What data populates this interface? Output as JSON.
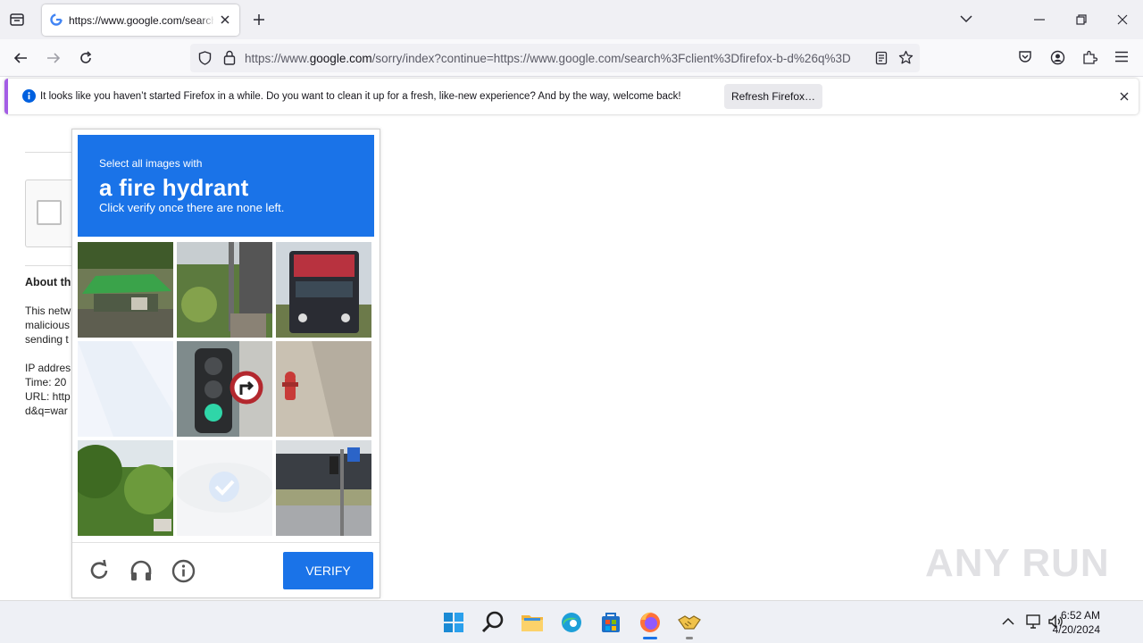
{
  "browser": {
    "tab": {
      "title": "https://www.google.com/search?client=firefox-b-d&q=war"
    },
    "url": {
      "prefix": "https://www.",
      "domain": "google.com",
      "rest": "/sorry/index?continue=https://www.google.com/search%3Fclient%3Dfirefox-b-d%26q%3D"
    },
    "notification": {
      "message": "It looks like you haven’t started Firefox in a while. Do you want to clean it up for a fresh, like-new experience? And by the way, welcome back!",
      "button_label": "Refresh Firefox…"
    }
  },
  "page": {
    "about_heading": "About th",
    "para_lines": [
      "This netw",
      "malicious",
      "sending t"
    ],
    "info_lines": [
      "IP addres",
      "Time: 20",
      "URL: http",
      "d&q=war"
    ]
  },
  "captcha": {
    "instruction_small": "Select all images with",
    "target": "a fire hydrant",
    "instruction_note": "Click verify once there are none left.",
    "verify_label": "VERIFY",
    "tiles": [
      {
        "name": "tile-green-tent",
        "selected": false
      },
      {
        "name": "tile-lamp-post-garden",
        "selected": false
      },
      {
        "name": "tile-truck",
        "selected": false
      },
      {
        "name": "tile-faded",
        "selected": false
      },
      {
        "name": "tile-traffic-light",
        "selected": false
      },
      {
        "name": "tile-fire-hydrant",
        "selected": false
      },
      {
        "name": "tile-trees",
        "selected": false
      },
      {
        "name": "tile-selected-check",
        "selected": true
      },
      {
        "name": "tile-street-sign",
        "selected": false
      }
    ]
  },
  "taskbar": {
    "time": "6:52 AM",
    "date": "4/20/2024"
  },
  "watermark": "ANY RUN",
  "colors": {
    "accent": "#1a73e8",
    "toolbar": "#f0f0f4",
    "notification_bar": "#a45ee5"
  }
}
